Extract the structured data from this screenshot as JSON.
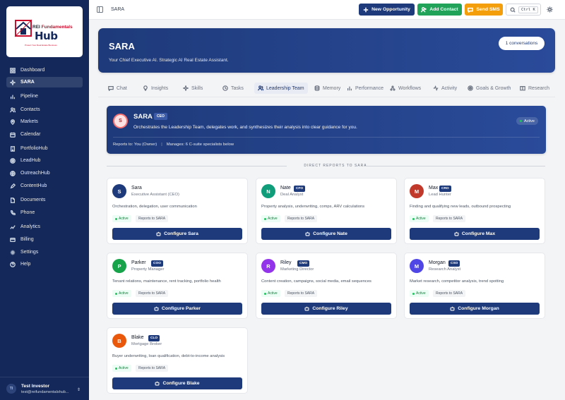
{
  "logo": {
    "text_prefix": "REI ",
    "text_accent": "Fundamentals",
    "text_main": "Hub",
    "tagline": "Protect Your Real Estate Business"
  },
  "sidebar": {
    "items": [
      {
        "label": "Dashboard",
        "icon": "grid-icon"
      },
      {
        "label": "SARA",
        "icon": "sparkle-icon",
        "active": true
      },
      {
        "label": "Pipeline",
        "icon": "bar-chart-icon"
      },
      {
        "label": "Contacts",
        "icon": "users-icon"
      },
      {
        "label": "Markets",
        "icon": "map-pin-icon"
      },
      {
        "label": "Calendar",
        "icon": "calendar-icon"
      },
      {
        "label": "PortfolioHub",
        "icon": "building-icon"
      },
      {
        "label": "LeadHub",
        "icon": "target-icon"
      },
      {
        "label": "OutreachHub",
        "icon": "globe-icon"
      },
      {
        "label": "ContentHub",
        "icon": "edit-icon"
      },
      {
        "label": "Documents",
        "icon": "file-icon"
      },
      {
        "label": "Phone",
        "icon": "phone-icon"
      },
      {
        "label": "Analytics",
        "icon": "analytics-icon"
      },
      {
        "label": "Billing",
        "icon": "card-icon"
      },
      {
        "label": "Settings",
        "icon": "gear-icon"
      },
      {
        "label": "Help",
        "icon": "help-icon"
      }
    ]
  },
  "user": {
    "initials": "TI",
    "name": "Test Investor",
    "email": "test@reifundamentalshub..."
  },
  "topbar": {
    "breadcrumb": "SARA",
    "new_opportunity": "New Opportunity",
    "add_contact": "Add Contact",
    "send_sms": "Send SMS",
    "search_shortcut": "Ctrl K"
  },
  "hero": {
    "title": "SARA",
    "subtitle": "Your Chief Executive AI. Strategic AI Real Estate Assistant.",
    "conversations": "1 conversations"
  },
  "tabs": [
    {
      "label": "Chat",
      "icon": "chat-icon"
    },
    {
      "label": "Insights",
      "icon": "lightbulb-icon"
    },
    {
      "label": "Skills",
      "icon": "sparkle-icon"
    },
    {
      "label": "Tasks",
      "icon": "clock-icon"
    },
    {
      "label": "Leadership Team",
      "icon": "users-icon",
      "active": true
    },
    {
      "label": "Memory",
      "icon": "database-icon"
    },
    {
      "label": "Performance",
      "icon": "bar-chart-icon"
    },
    {
      "label": "Workflows",
      "icon": "workflow-icon"
    },
    {
      "label": "Activity",
      "icon": "activity-icon"
    },
    {
      "label": "Goals & Growth",
      "icon": "target-icon"
    },
    {
      "label": "Research",
      "icon": "book-icon"
    }
  ],
  "sara_card": {
    "initial": "S",
    "name": "SARA",
    "badge": "CEO",
    "description": "Orchestrates the Leadership Team, delegates work, and synthesizes their analysis into clear guidance for you.",
    "status": "Active",
    "reports_to": "Reports to: You (Owner)",
    "manages": "Manages: 6 C-suite specialists below"
  },
  "direct_reports_label": "DIRECT REPORTS TO SARA",
  "agents": [
    {
      "initial": "S",
      "name": "Sara",
      "badge": "",
      "role": "Executive Assistant (CEO)",
      "description": "Orchestration, delegation, user communication",
      "status": "Active",
      "reports": "Reports to SARA",
      "button": "Configure Sara",
      "color": "#1e3a7a"
    },
    {
      "initial": "N",
      "name": "Nate",
      "badge": "CFO",
      "role": "Deal Analyst",
      "description": "Property analysis, underwriting, comps, ARV calculations",
      "status": "Active",
      "reports": "Reports to SARA",
      "button": "Configure Nate",
      "color": "#0f9d7a"
    },
    {
      "initial": "M",
      "name": "Max",
      "badge": "CRO",
      "role": "Lead Hunter",
      "description": "Finding and qualifying new leads, outbound prospecting",
      "status": "Active",
      "reports": "Reports to SARA",
      "button": "Configure Max",
      "color": "#c0392b"
    },
    {
      "initial": "P",
      "name": "Parker",
      "badge": "COO",
      "role": "Property Manager",
      "description": "Tenant relations, maintenance, rent tracking, portfolio health",
      "status": "Active",
      "reports": "Reports to SARA",
      "button": "Configure Parker",
      "color": "#16a34a"
    },
    {
      "initial": "R",
      "name": "Riley",
      "badge": "CMO",
      "role": "Marketing Director",
      "description": "Content creation, campaigns, social media, email sequences",
      "status": "Active",
      "reports": "Reports to SARA",
      "button": "Configure Riley",
      "color": "#9333ea"
    },
    {
      "initial": "M",
      "name": "Morgan",
      "badge": "CSO",
      "role": "Research Analyst",
      "description": "Market research, competitor analysis, trend spotting",
      "status": "Active",
      "reports": "Reports to SARA",
      "button": "Configure Morgan",
      "color": "#4f46e5"
    },
    {
      "initial": "B",
      "name": "Blake",
      "badge": "CLO",
      "role": "Mortgage Broker",
      "description": "Buyer underwriting, loan qualification, debt-to-income analysis",
      "status": "Active",
      "reports": "Reports to SARA",
      "button": "Configure Blake",
      "color": "#ea580c"
    }
  ]
}
